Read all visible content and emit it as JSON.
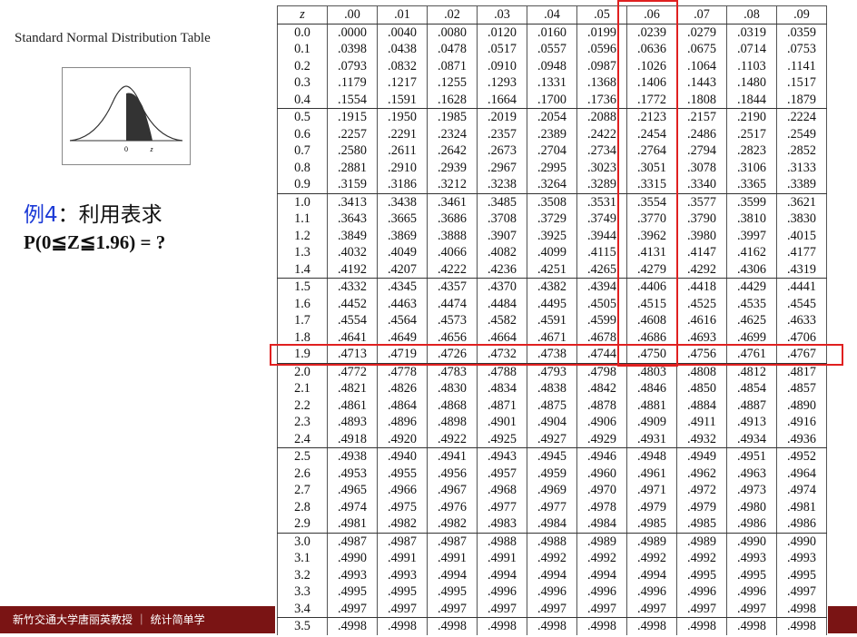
{
  "left_title": "Standard Normal Distribution Table",
  "figure": {
    "label_zero": "0",
    "label_z": "z"
  },
  "example": {
    "label": "例4",
    "colon": "：",
    "text": "利用表求",
    "question": "P(0≦Z≦1.96) = ?"
  },
  "table": {
    "headers": [
      "z",
      ".00",
      ".01",
      ".02",
      ".03",
      ".04",
      ".05",
      ".06",
      ".07",
      ".08",
      ".09"
    ],
    "rows": [
      [
        "0.0",
        ".0000",
        ".0040",
        ".0080",
        ".0120",
        ".0160",
        ".0199",
        ".0239",
        ".0279",
        ".0319",
        ".0359"
      ],
      [
        "0.1",
        ".0398",
        ".0438",
        ".0478",
        ".0517",
        ".0557",
        ".0596",
        ".0636",
        ".0675",
        ".0714",
        ".0753"
      ],
      [
        "0.2",
        ".0793",
        ".0832",
        ".0871",
        ".0910",
        ".0948",
        ".0987",
        ".1026",
        ".1064",
        ".1103",
        ".1141"
      ],
      [
        "0.3",
        ".1179",
        ".1217",
        ".1255",
        ".1293",
        ".1331",
        ".1368",
        ".1406",
        ".1443",
        ".1480",
        ".1517"
      ],
      [
        "0.4",
        ".1554",
        ".1591",
        ".1628",
        ".1664",
        ".1700",
        ".1736",
        ".1772",
        ".1808",
        ".1844",
        ".1879"
      ],
      [
        "0.5",
        ".1915",
        ".1950",
        ".1985",
        ".2019",
        ".2054",
        ".2088",
        ".2123",
        ".2157",
        ".2190",
        ".2224"
      ],
      [
        "0.6",
        ".2257",
        ".2291",
        ".2324",
        ".2357",
        ".2389",
        ".2422",
        ".2454",
        ".2486",
        ".2517",
        ".2549"
      ],
      [
        "0.7",
        ".2580",
        ".2611",
        ".2642",
        ".2673",
        ".2704",
        ".2734",
        ".2764",
        ".2794",
        ".2823",
        ".2852"
      ],
      [
        "0.8",
        ".2881",
        ".2910",
        ".2939",
        ".2967",
        ".2995",
        ".3023",
        ".3051",
        ".3078",
        ".3106",
        ".3133"
      ],
      [
        "0.9",
        ".3159",
        ".3186",
        ".3212",
        ".3238",
        ".3264",
        ".3289",
        ".3315",
        ".3340",
        ".3365",
        ".3389"
      ],
      [
        "1.0",
        ".3413",
        ".3438",
        ".3461",
        ".3485",
        ".3508",
        ".3531",
        ".3554",
        ".3577",
        ".3599",
        ".3621"
      ],
      [
        "1.1",
        ".3643",
        ".3665",
        ".3686",
        ".3708",
        ".3729",
        ".3749",
        ".3770",
        ".3790",
        ".3810",
        ".3830"
      ],
      [
        "1.2",
        ".3849",
        ".3869",
        ".3888",
        ".3907",
        ".3925",
        ".3944",
        ".3962",
        ".3980",
        ".3997",
        ".4015"
      ],
      [
        "1.3",
        ".4032",
        ".4049",
        ".4066",
        ".4082",
        ".4099",
        ".4115",
        ".4131",
        ".4147",
        ".4162",
        ".4177"
      ],
      [
        "1.4",
        ".4192",
        ".4207",
        ".4222",
        ".4236",
        ".4251",
        ".4265",
        ".4279",
        ".4292",
        ".4306",
        ".4319"
      ],
      [
        "1.5",
        ".4332",
        ".4345",
        ".4357",
        ".4370",
        ".4382",
        ".4394",
        ".4406",
        ".4418",
        ".4429",
        ".4441"
      ],
      [
        "1.6",
        ".4452",
        ".4463",
        ".4474",
        ".4484",
        ".4495",
        ".4505",
        ".4515",
        ".4525",
        ".4535",
        ".4545"
      ],
      [
        "1.7",
        ".4554",
        ".4564",
        ".4573",
        ".4582",
        ".4591",
        ".4599",
        ".4608",
        ".4616",
        ".4625",
        ".4633"
      ],
      [
        "1.8",
        ".4641",
        ".4649",
        ".4656",
        ".4664",
        ".4671",
        ".4678",
        ".4686",
        ".4693",
        ".4699",
        ".4706"
      ],
      [
        "1.9",
        ".4713",
        ".4719",
        ".4726",
        ".4732",
        ".4738",
        ".4744",
        ".4750",
        ".4756",
        ".4761",
        ".4767"
      ],
      [
        "2.0",
        ".4772",
        ".4778",
        ".4783",
        ".4788",
        ".4793",
        ".4798",
        ".4803",
        ".4808",
        ".4812",
        ".4817"
      ],
      [
        "2.1",
        ".4821",
        ".4826",
        ".4830",
        ".4834",
        ".4838",
        ".4842",
        ".4846",
        ".4850",
        ".4854",
        ".4857"
      ],
      [
        "2.2",
        ".4861",
        ".4864",
        ".4868",
        ".4871",
        ".4875",
        ".4878",
        ".4881",
        ".4884",
        ".4887",
        ".4890"
      ],
      [
        "2.3",
        ".4893",
        ".4896",
        ".4898",
        ".4901",
        ".4904",
        ".4906",
        ".4909",
        ".4911",
        ".4913",
        ".4916"
      ],
      [
        "2.4",
        ".4918",
        ".4920",
        ".4922",
        ".4925",
        ".4927",
        ".4929",
        ".4931",
        ".4932",
        ".4934",
        ".4936"
      ],
      [
        "2.5",
        ".4938",
        ".4940",
        ".4941",
        ".4943",
        ".4945",
        ".4946",
        ".4948",
        ".4949",
        ".4951",
        ".4952"
      ],
      [
        "2.6",
        ".4953",
        ".4955",
        ".4956",
        ".4957",
        ".4959",
        ".4960",
        ".4961",
        ".4962",
        ".4963",
        ".4964"
      ],
      [
        "2.7",
        ".4965",
        ".4966",
        ".4967",
        ".4968",
        ".4969",
        ".4970",
        ".4971",
        ".4972",
        ".4973",
        ".4974"
      ],
      [
        "2.8",
        ".4974",
        ".4975",
        ".4976",
        ".4977",
        ".4977",
        ".4978",
        ".4979",
        ".4979",
        ".4980",
        ".4981"
      ],
      [
        "2.9",
        ".4981",
        ".4982",
        ".4982",
        ".4983",
        ".4984",
        ".4984",
        ".4985",
        ".4985",
        ".4986",
        ".4986"
      ],
      [
        "3.0",
        ".4987",
        ".4987",
        ".4987",
        ".4988",
        ".4988",
        ".4989",
        ".4989",
        ".4989",
        ".4990",
        ".4990"
      ],
      [
        "3.1",
        ".4990",
        ".4991",
        ".4991",
        ".4991",
        ".4992",
        ".4992",
        ".4992",
        ".4992",
        ".4993",
        ".4993"
      ],
      [
        "3.2",
        ".4993",
        ".4993",
        ".4994",
        ".4994",
        ".4994",
        ".4994",
        ".4994",
        ".4995",
        ".4995",
        ".4995"
      ],
      [
        "3.3",
        ".4995",
        ".4995",
        ".4995",
        ".4996",
        ".4996",
        ".4996",
        ".4996",
        ".4996",
        ".4996",
        ".4997"
      ],
      [
        "3.4",
        ".4997",
        ".4997",
        ".4997",
        ".4997",
        ".4997",
        ".4997",
        ".4997",
        ".4997",
        ".4997",
        ".4998"
      ],
      [
        "3.5",
        ".4998",
        ".4998",
        ".4998",
        ".4998",
        ".4998",
        ".4998",
        ".4998",
        ".4998",
        ".4998",
        ".4998"
      ]
    ],
    "highlight_color": "#e02020"
  },
  "footer": {
    "text": "新竹交通大学唐丽英教授 ｜ 统计简单学",
    "color": "#7a1414"
  }
}
